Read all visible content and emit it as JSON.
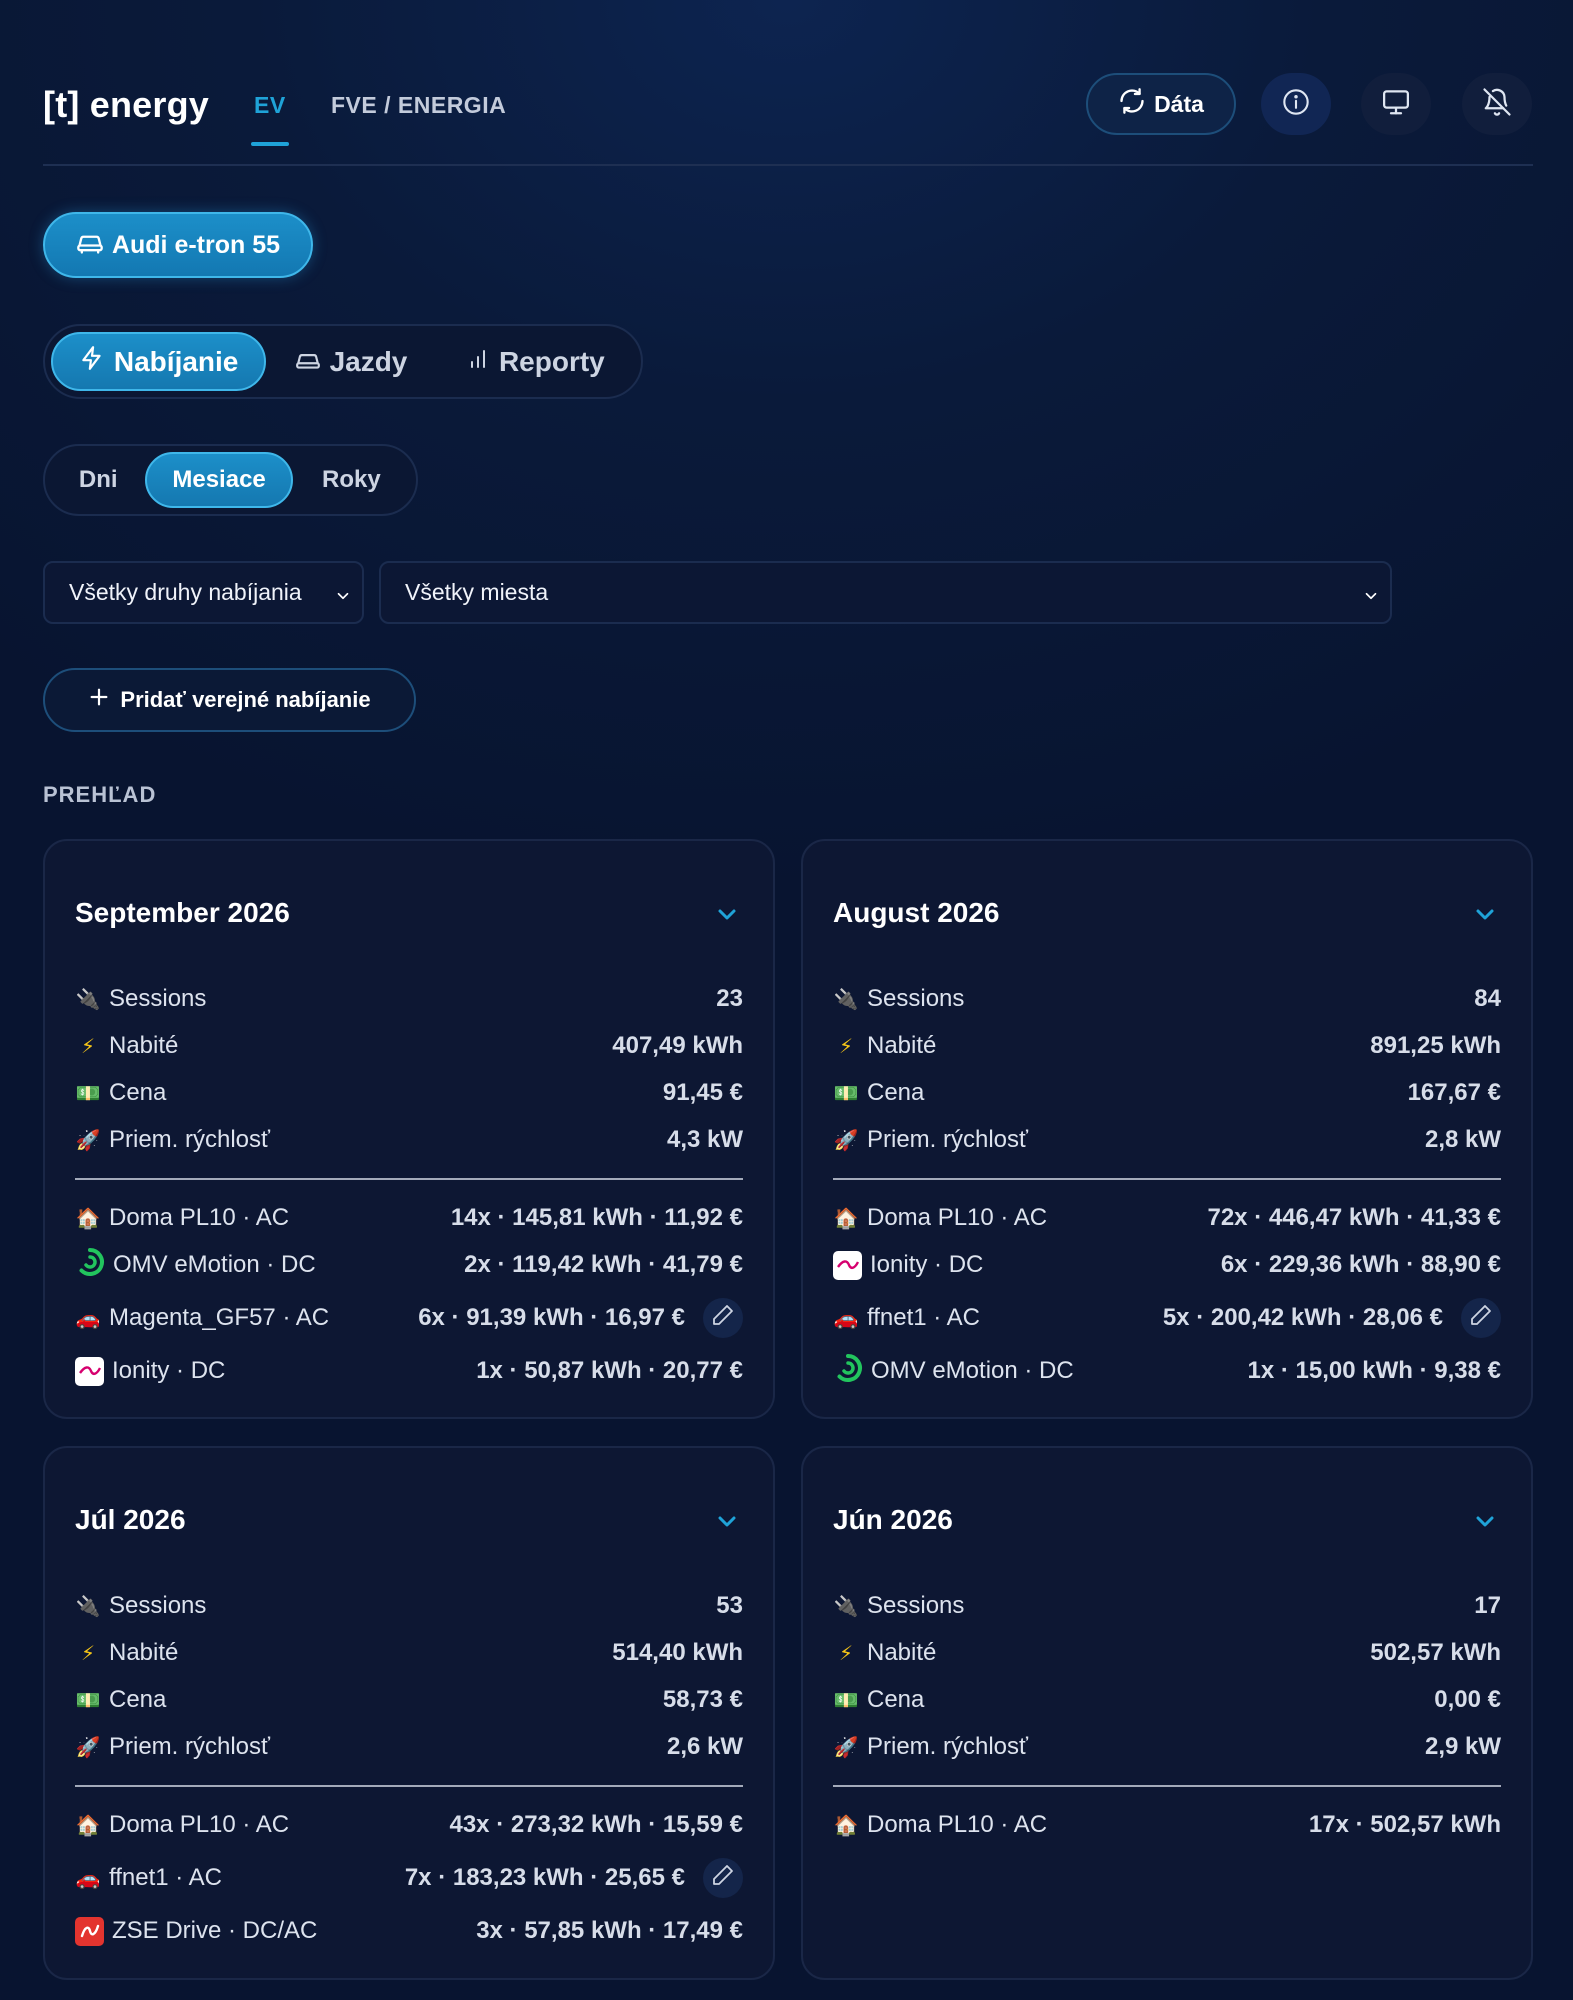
{
  "header": {
    "logo": "[t] energy",
    "tabs": [
      {
        "label": "EV",
        "active": true
      },
      {
        "label": "FVE / ENERGIA",
        "active": false
      }
    ],
    "data_button": "Dáta",
    "icons": [
      "refresh-icon",
      "info-icon",
      "monitor-icon",
      "bell-off-icon"
    ]
  },
  "vehicle": {
    "label": "Audi e-tron 55",
    "icon": "car-icon"
  },
  "main_tabs": [
    {
      "label": "Nabíjanie",
      "icon": "lightning-icon",
      "active": true
    },
    {
      "label": "Jazdy",
      "icon": "car-icon",
      "active": false
    },
    {
      "label": "Reporty",
      "icon": "bar-chart-icon",
      "active": false
    }
  ],
  "period_tabs": [
    {
      "label": "Dni",
      "active": false
    },
    {
      "label": "Mesiace",
      "active": true
    },
    {
      "label": "Roky",
      "active": false
    }
  ],
  "filters": {
    "charging_type": "Všetky druhy nabíjania",
    "location": "Všetky miesta"
  },
  "add_button": "Pridať verejné nabíjanie",
  "overview_title": "PREHĽAD",
  "stat_labels": {
    "sessions": "Sessions",
    "charged": "Nabité",
    "price": "Cena",
    "speed": "Priem. rýchlosť"
  },
  "colors": {
    "accent": "#1fa3d8",
    "background": "#0a1a3a",
    "card": "#0d1733"
  },
  "months": [
    {
      "title": "September 2026",
      "sessions": "23",
      "charged": "407,49 kWh",
      "price": "91,45 €",
      "speed": "4,3 kW",
      "locations": [
        {
          "name": "Doma PL10 · AC",
          "icon": "house-icon",
          "detail": "14x · 145,81 kWh · 11,92 €"
        },
        {
          "name": "OMV eMotion · DC",
          "icon": "omv-logo-icon",
          "detail": "2x · 119,42 kWh · 41,79 €"
        },
        {
          "name": "Magenta_GF57 · AC",
          "icon": "red-car-icon",
          "detail": "6x · 91,39 kWh · 16,97 €",
          "editable": true
        },
        {
          "name": "Ionity · DC",
          "icon": "ionity-logo-icon",
          "detail": "1x · 50,87 kWh · 20,77 €"
        }
      ]
    },
    {
      "title": "August 2026",
      "sessions": "84",
      "charged": "891,25 kWh",
      "price": "167,67 €",
      "speed": "2,8 kW",
      "locations": [
        {
          "name": "Doma PL10 · AC",
          "icon": "house-icon",
          "detail": "72x · 446,47 kWh · 41,33 €"
        },
        {
          "name": "Ionity · DC",
          "icon": "ionity-logo-icon",
          "detail": "6x · 229,36 kWh · 88,90 €"
        },
        {
          "name": "ffnet1 · AC",
          "icon": "red-car-icon",
          "detail": "5x · 200,42 kWh · 28,06 €",
          "editable": true
        },
        {
          "name": "OMV eMotion · DC",
          "icon": "omv-logo-icon",
          "detail": "1x · 15,00 kWh · 9,38 €"
        }
      ]
    },
    {
      "title": "Júl 2026",
      "sessions": "53",
      "charged": "514,40 kWh",
      "price": "58,73 €",
      "speed": "2,6 kW",
      "locations": [
        {
          "name": "Doma PL10 · AC",
          "icon": "house-icon",
          "detail": "43x · 273,32 kWh · 15,59 €"
        },
        {
          "name": "ffnet1 · AC",
          "icon": "red-car-icon",
          "detail": "7x · 183,23 kWh · 25,65 €",
          "editable": true
        },
        {
          "name": "ZSE Drive · DC/AC",
          "icon": "zse-logo-icon",
          "detail": "3x · 57,85 kWh · 17,49 €"
        }
      ]
    },
    {
      "title": "Jún 2026",
      "sessions": "17",
      "charged": "502,57 kWh",
      "price": "0,00 €",
      "speed": "2,9 kW",
      "locations": [
        {
          "name": "Doma PL10 · AC",
          "icon": "house-icon",
          "detail": "17x · 502,57 kWh"
        }
      ]
    }
  ]
}
